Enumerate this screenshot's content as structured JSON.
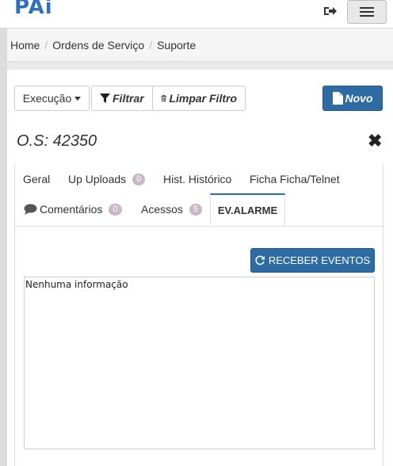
{
  "app": {
    "logo": "PAi"
  },
  "header": {
    "logout_icon": "sign-out-icon",
    "menu_icon": "hamburger-icon"
  },
  "breadcrumb": [
    "Home",
    "Ordens de Serviço",
    "Suporte"
  ],
  "toolbar": {
    "execucao_label": "Execução",
    "filtrar_label": "Filtrar",
    "limpar_label": "Limpar Filtro",
    "novo_label": "Novo"
  },
  "os": {
    "title": "O.S: 42350",
    "close_icon": "close-icon"
  },
  "tabs": [
    {
      "label": "Geral"
    },
    {
      "label": "Up Uploads",
      "badge": "0"
    },
    {
      "label": "Hist. Histórico"
    },
    {
      "label": "Ficha Ficha/Telnet"
    },
    {
      "label": "Comentários",
      "badge": "0",
      "icon": "comment-icon"
    },
    {
      "label": "Acessos",
      "badge": "5"
    },
    {
      "label": "EV.ALARME",
      "active": true
    }
  ],
  "events": {
    "button_label": "RECEBER EVENTOS",
    "content": "Nenhuma informação"
  },
  "colors": {
    "primary": "#2d6ca2",
    "badge": "#c9b8c6"
  }
}
